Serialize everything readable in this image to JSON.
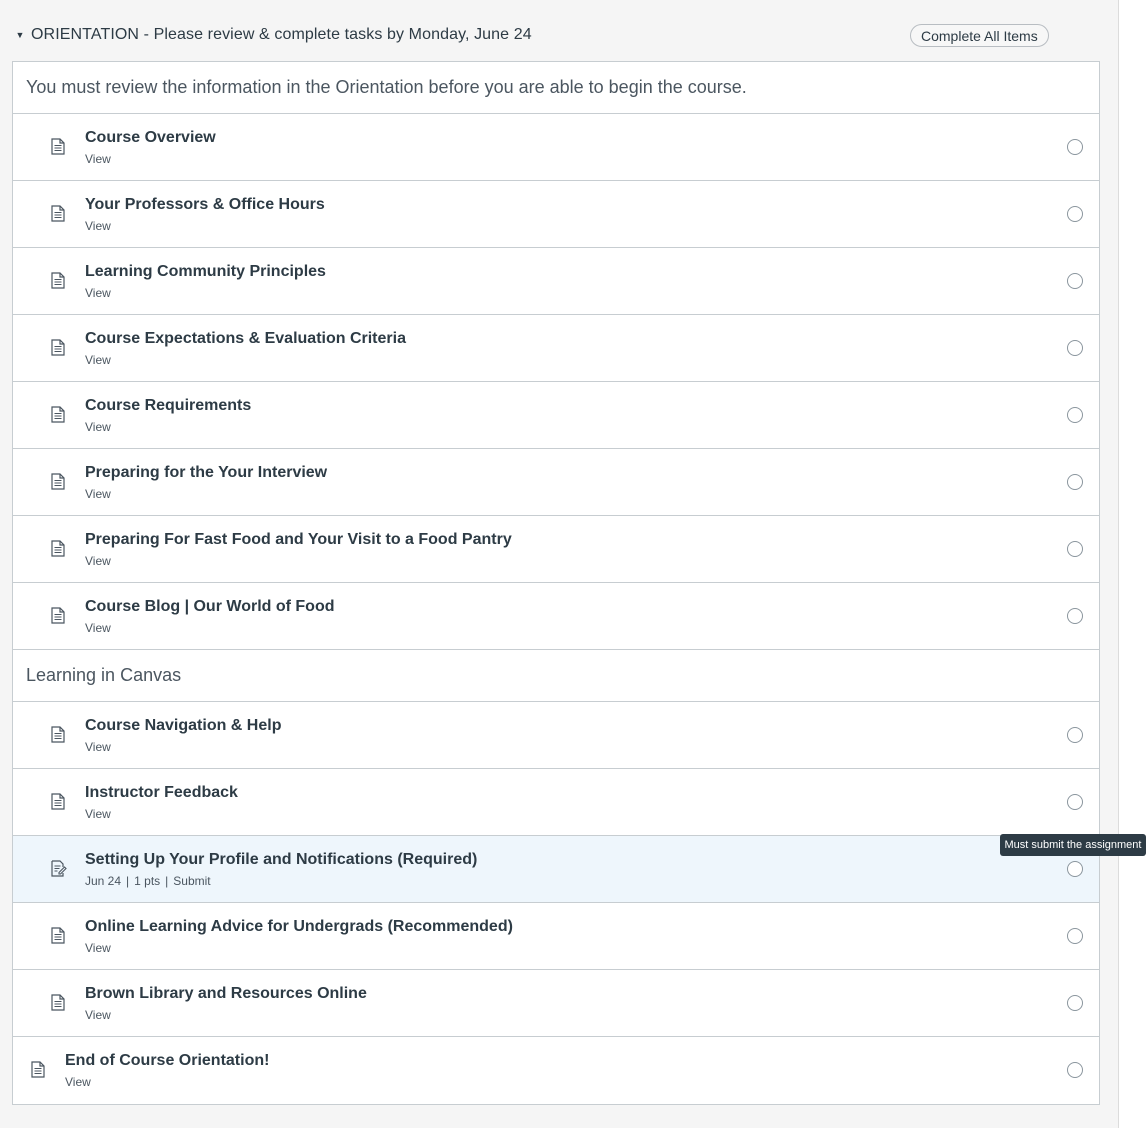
{
  "module": {
    "toggle_icon": "caret-down-icon",
    "title": "ORIENTATION - Please review & complete tasks by Monday, June 24",
    "complete_all_label": "Complete All Items"
  },
  "sections": [
    {
      "header": "You must review the information in the Orientation before you are able to begin the course.",
      "items": [
        {
          "title": "Course Overview",
          "action": "View",
          "icon": "page-icon"
        },
        {
          "title": "Your Professors & Office Hours",
          "action": "View",
          "icon": "page-icon"
        },
        {
          "title": "Learning Community Principles",
          "action": "View",
          "icon": "page-icon"
        },
        {
          "title": "Course Expectations & Evaluation Criteria",
          "action": "View",
          "icon": "page-icon"
        },
        {
          "title": "Course Requirements",
          "action": "View",
          "icon": "page-icon"
        },
        {
          "title": "Preparing for the Your Interview",
          "action": "View",
          "icon": "page-icon"
        },
        {
          "title": "Preparing For Fast Food and Your Visit to a Food Pantry",
          "action": "View",
          "icon": "page-icon"
        },
        {
          "title": "Course Blog | Our World of Food",
          "action": "View",
          "icon": "page-icon"
        }
      ]
    },
    {
      "header": "Learning in Canvas",
      "items": [
        {
          "title": "Course Navigation & Help",
          "action": "View",
          "icon": "page-icon"
        },
        {
          "title": "Instructor Feedback",
          "action": "View",
          "icon": "page-icon"
        },
        {
          "title": "Setting Up Your Profile and Notifications (Required)",
          "due": "Jun 24",
          "points": "1 pts",
          "action": "Submit",
          "icon": "assignment-icon",
          "highlighted": true
        },
        {
          "title": "Online Learning Advice for Undergrads (Recommended)",
          "action": "View",
          "icon": "page-icon"
        },
        {
          "title": "Brown Library and Resources Online",
          "action": "View",
          "icon": "page-icon"
        },
        {
          "title": "End of Course Orientation!",
          "action": "View",
          "icon": "page-icon",
          "outdented": true
        }
      ]
    }
  ],
  "tooltip": "Must submit the assignment",
  "status_icon": "empty-circle-icon",
  "colors": {
    "highlight_row": "#eef6fc",
    "text": "#2d3b45",
    "border": "#c7cdd1",
    "tooltip_bg": "#2d3b45"
  }
}
